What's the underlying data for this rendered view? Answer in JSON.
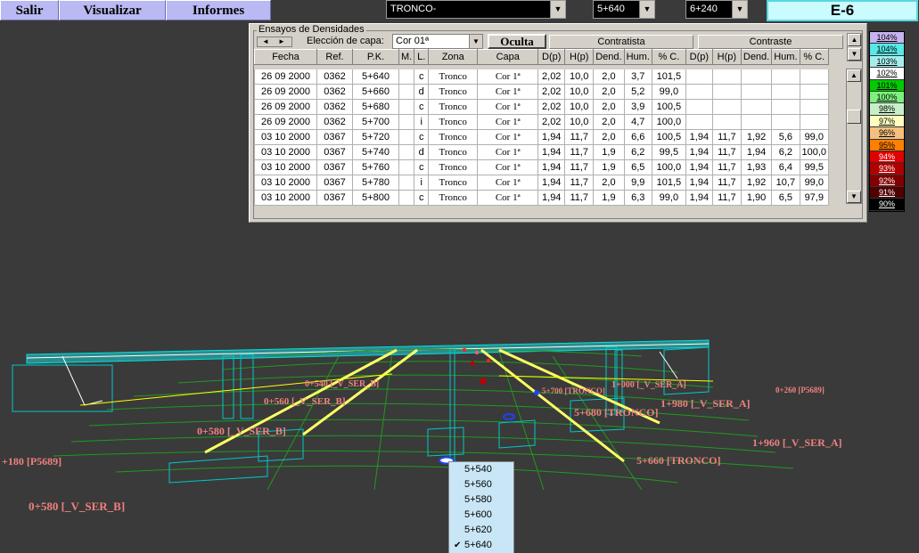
{
  "menu": {
    "salir": "Salir",
    "visualizar": "Visualizar",
    "informes": "Informes"
  },
  "selectors": {
    "tronco": "TRONCO-",
    "pk_from": "5+640",
    "pk_to": "6+240"
  },
  "badge": "E-6",
  "panel": {
    "title": "Ensayos de Densidades",
    "capa_label": "Elección de capa:",
    "capa_value": "Cor 01ª",
    "oculta_label": "Oculta",
    "contratista_label": "Contratista",
    "contraste_label": "Contraste",
    "columns": [
      "Fecha",
      "Ref.",
      "P.K.",
      "M.",
      "L.",
      "Zona",
      "Capa",
      "D(p)",
      "H(p)",
      "Dend.",
      "Hum.",
      "% C.",
      "D(p)",
      "H(p)",
      "Dend.",
      "Hum.",
      "% C."
    ],
    "rows": [
      [
        "26 09 2000",
        "0362",
        "5+640",
        "",
        "c",
        "Tronco",
        "Cor 1ª",
        "2,02",
        "10,0",
        "2,0",
        "3,7",
        "101,5",
        "",
        "",
        "",
        "",
        ""
      ],
      [
        "26 09 2000",
        "0362",
        "5+660",
        "",
        "d",
        "Tronco",
        "Cor 1ª",
        "2,02",
        "10,0",
        "2,0",
        "5,2",
        "99,0",
        "",
        "",
        "",
        "",
        ""
      ],
      [
        "26 09 2000",
        "0362",
        "5+680",
        "",
        "c",
        "Tronco",
        "Cor 1ª",
        "2,02",
        "10,0",
        "2,0",
        "3,9",
        "100,5",
        "",
        "",
        "",
        "",
        ""
      ],
      [
        "26 09 2000",
        "0362",
        "5+700",
        "",
        "i",
        "Tronco",
        "Cor 1ª",
        "2,02",
        "10,0",
        "2,0",
        "4,7",
        "100,0",
        "",
        "",
        "",
        "",
        ""
      ],
      [
        "03 10 2000",
        "0367",
        "5+720",
        "",
        "c",
        "Tronco",
        "Cor 1ª",
        "1,94",
        "11,7",
        "2,0",
        "6,6",
        "100,5",
        "1,94",
        "11,7",
        "1,92",
        "5,6",
        "99,0"
      ],
      [
        "03 10 2000",
        "0367",
        "5+740",
        "",
        "d",
        "Tronco",
        "Cor 1ª",
        "1,94",
        "11,7",
        "1,9",
        "6,2",
        "99,5",
        "1,94",
        "11,7",
        "1,94",
        "6,2",
        "100,0"
      ],
      [
        "03 10 2000",
        "0367",
        "5+760",
        "",
        "c",
        "Tronco",
        "Cor 1ª",
        "1,94",
        "11,7",
        "1,9",
        "6,5",
        "100,0",
        "1,94",
        "11,7",
        "1,93",
        "6,4",
        "99,5"
      ],
      [
        "03 10 2000",
        "0367",
        "5+780",
        "",
        "i",
        "Tronco",
        "Cor 1ª",
        "1,94",
        "11,7",
        "2,0",
        "9,9",
        "101,5",
        "1,94",
        "11,7",
        "1,92",
        "10,7",
        "99,0"
      ],
      [
        "03 10 2000",
        "0367",
        "5+800",
        "",
        "c",
        "Tronco",
        "Cor 1ª",
        "1,94",
        "11,7",
        "1,9",
        "6,3",
        "99,0",
        "1,94",
        "11,7",
        "1,90",
        "6,5",
        "97,9"
      ]
    ]
  },
  "legend": [
    {
      "label": "104%",
      "color": "#c6b4f0"
    },
    {
      "label": "104%",
      "color": "#58e8e8"
    },
    {
      "label": "103%",
      "color": "#a6eeee"
    },
    {
      "label": "102%",
      "color": "#ffffff"
    },
    {
      "label": "101%",
      "color": "#00cc00"
    },
    {
      "label": "100%",
      "color": "#7ef07e"
    },
    {
      "label": "98%",
      "color": "#c8f0c8"
    },
    {
      "label": "97%",
      "color": "#ffffc0"
    },
    {
      "label": "96%",
      "color": "#f4c080"
    },
    {
      "label": "95%",
      "color": "#ff8000"
    },
    {
      "label": "94%",
      "color": "#e00000"
    },
    {
      "label": "93%",
      "color": "#b00000"
    },
    {
      "label": "92%",
      "color": "#800000"
    },
    {
      "label": "91%",
      "color": "#500000"
    },
    {
      "label": "90%",
      "color": "#000000"
    }
  ],
  "view_labels": {
    "l1": "0+580 [_V_SER_B]",
    "l2": "0+540 [_V_SER_B]",
    "l3": "0+560 [_V_SER_B]",
    "l4": "+180 [P5689]",
    "l5": "0+580 [_V_SER_B]",
    "l6": "5+700 [TRONCO]",
    "l7": "1+000 [_V_SER_A]",
    "l8": "0+260 [P5689]",
    "l9": "1+980 [_V_SER_A]",
    "l10": "5+680 [TRONCO]",
    "l11": "1+960 [_V_SER_A]",
    "l12": "5+660 [TRONCO]"
  },
  "dropdown": {
    "items": [
      "5+540",
      "5+560",
      "5+580",
      "5+600",
      "5+620",
      "5+640"
    ],
    "selected": "5+640",
    "check_icon": "check-icon"
  }
}
